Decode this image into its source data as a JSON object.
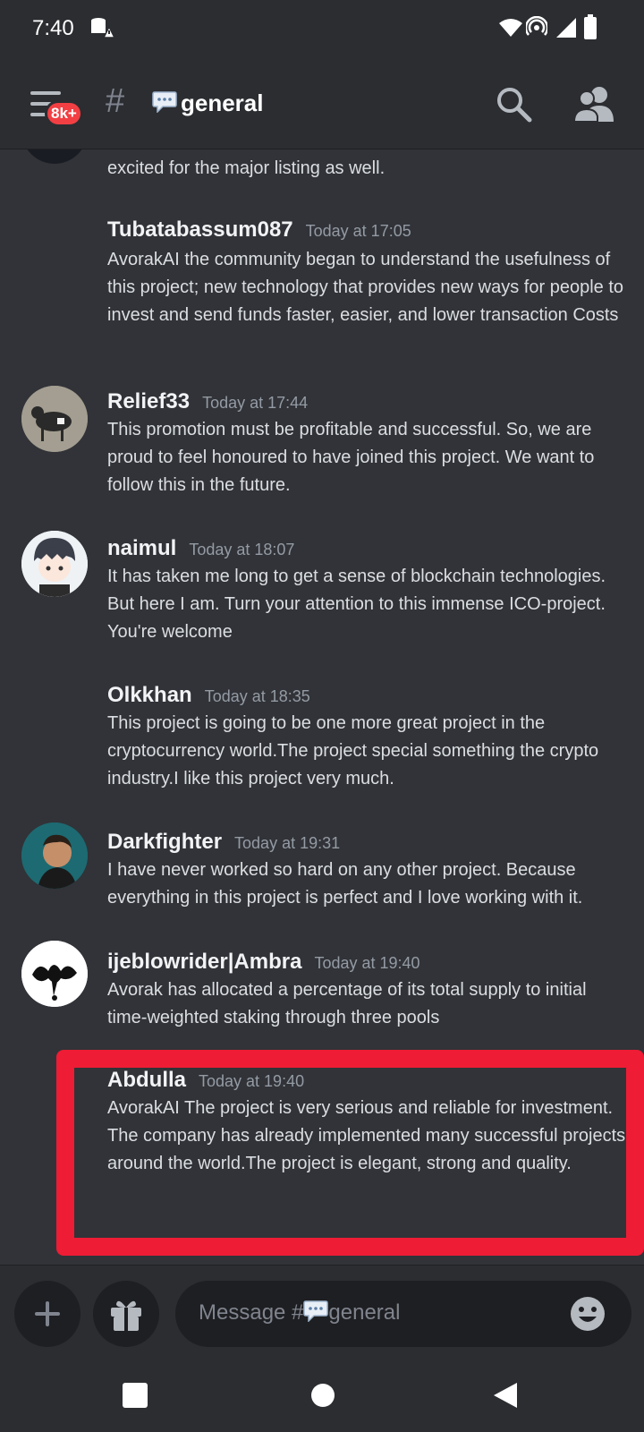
{
  "status_bar": {
    "time": "7:40"
  },
  "header": {
    "badge": "8k+",
    "channel_name": "general"
  },
  "messages": [
    {
      "author": "",
      "time": "",
      "text": "excited for the major listing as well."
    },
    {
      "author": "Tubatabassum087",
      "time": "Today at 17:05",
      "text": "AvorakAI the community began to understand the usefulness of this project; new technology that provides new ways for people to invest and send funds faster, easier, and lower transaction Costs"
    },
    {
      "author": "Relief33",
      "time": "Today at 17:44",
      "text": "This promotion must be profitable and successful. So, we are proud to feel honoured to have joined this project. We want to follow this in the future."
    },
    {
      "author": "naimul",
      "time": "Today at 18:07",
      "text": "It has taken me long to get a sense of blockchain technologies. But here I am. Turn your attention to this immense ICO-project. You're welcome"
    },
    {
      "author": "Olkkhan",
      "time": "Today at 18:35",
      "text": "This project is going to be one more great project in the cryptocurrency world.The project special something the crypto industry.I like this project very much."
    },
    {
      "author": "Darkfighter",
      "time": "Today at 19:31",
      "text": "I have never worked so hard on any other project. Because everything in this project is perfect and I love working with it."
    },
    {
      "author": "ijeblowrider|Ambra",
      "time": "Today at 19:40",
      "text": "Avorak has allocated a percentage of its total supply to initial time-weighted staking through three pools"
    },
    {
      "author": "Abdulla",
      "time": "Today at 19:40",
      "text": "AvorakAI The project is very serious and reliable for investment. The company has already implemented many successful projects around the world.The project is elegant, strong and quality."
    }
  ],
  "composer": {
    "placeholder_prefix": "Message #",
    "placeholder_channel": "general"
  },
  "colors": {
    "background": "#313338",
    "bars": "#2b2d31",
    "badge": "#f23f43",
    "highlight": "#ee1c35"
  },
  "icons": [
    "menu-icon",
    "hash-icon",
    "speech-bubble-icon",
    "search-icon",
    "members-icon",
    "plus-icon",
    "gift-icon",
    "emoji-icon",
    "home-icon",
    "back-icon",
    "recents-icon"
  ]
}
